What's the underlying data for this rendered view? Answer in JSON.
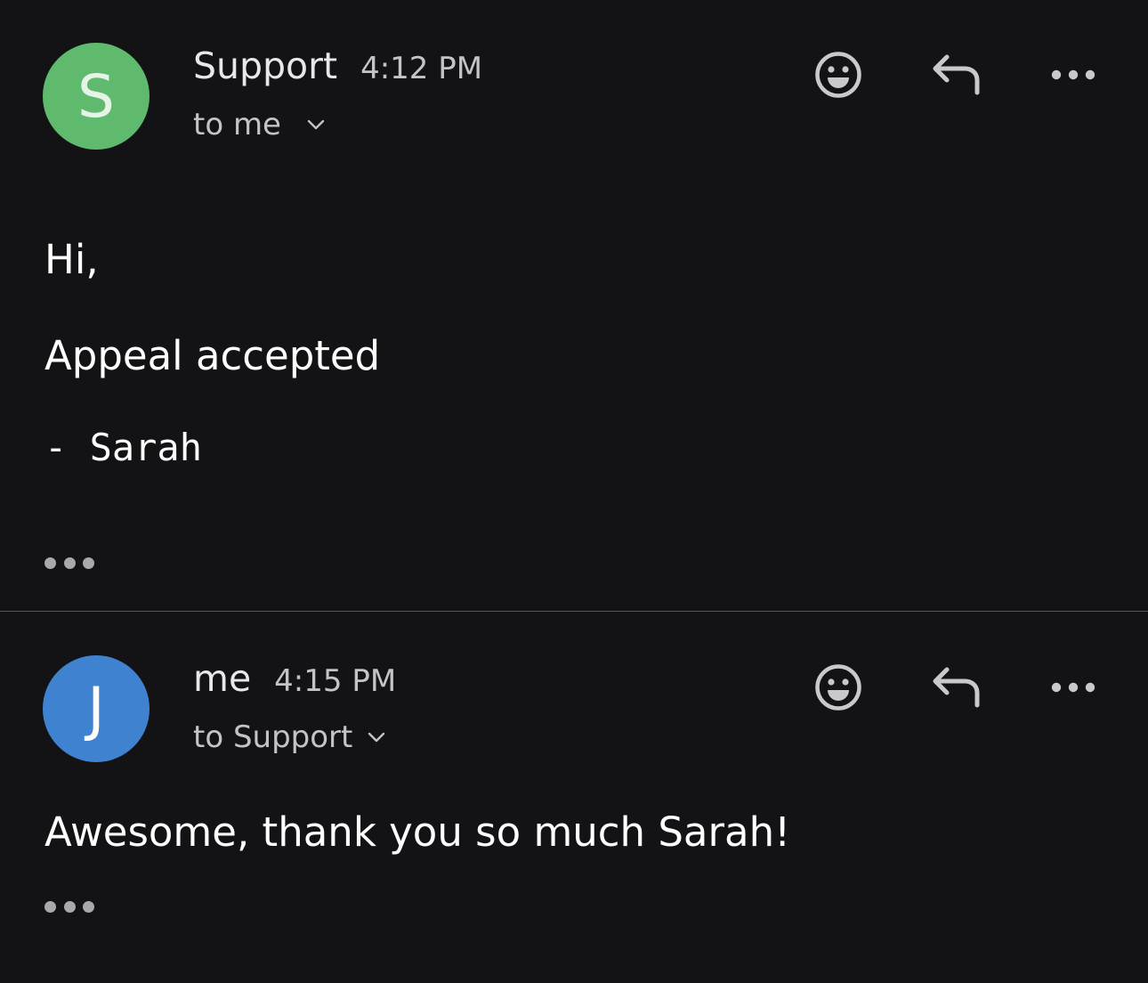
{
  "colors": {
    "background": "#131316",
    "support_avatar": "#5fba6e",
    "me_avatar": "#3e82d0",
    "icon": "#c9c9cc"
  },
  "messages": [
    {
      "avatar_letter": "S",
      "sender": "Support",
      "time": "4:12 PM",
      "recipient": "to me",
      "body": {
        "greeting": "Hi,",
        "main": "Appeal accepted",
        "signature": "- Sarah"
      },
      "actions": [
        "smiley-icon",
        "reply-icon",
        "more-icon"
      ]
    },
    {
      "avatar_letter": "J",
      "sender": "me",
      "time": "4:15 PM",
      "recipient": "to Support",
      "body": {
        "text": "Awesome, thank you so much Sarah!"
      },
      "actions": [
        "smiley-icon",
        "reply-icon",
        "more-icon"
      ]
    }
  ]
}
